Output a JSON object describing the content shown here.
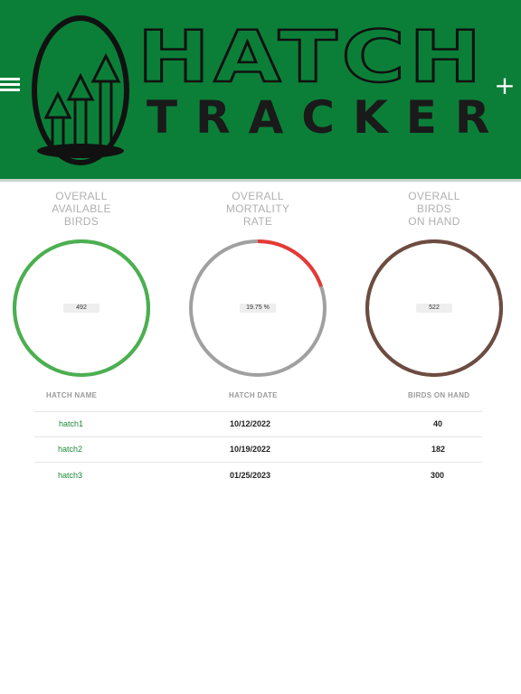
{
  "header": {
    "brand_top": "HATCH",
    "brand_bottom": "TRACKER",
    "menu_icon": "hamburger-menu-icon",
    "add_icon": "plus-icon",
    "add_label": "+"
  },
  "stats": [
    {
      "label_lines": [
        "OVERALL",
        "AVAILABLE",
        "BIRDS"
      ],
      "value": "492",
      "color": "#4caf50",
      "fraction": 1.0,
      "track_color": "#4caf50"
    },
    {
      "label_lines": [
        "OVERALL",
        "MORTALITY",
        "RATE"
      ],
      "value": "19.75 %",
      "color": "#e53935",
      "fraction": 0.1975,
      "track_color": "#a0a0a0"
    },
    {
      "label_lines": [
        "OVERALL",
        "BIRDS",
        "ON HAND"
      ],
      "value": "522",
      "color": "#6d4c41",
      "fraction": 1.0,
      "track_color": "#6d4c41"
    }
  ],
  "table": {
    "headers": [
      "HATCH NAME",
      "HATCH DATE",
      "BIRDS ON HAND"
    ],
    "rows": [
      {
        "name": "hatch1",
        "date": "10/12/2022",
        "birds": "40"
      },
      {
        "name": "hatch2",
        "date": "10/19/2022",
        "birds": "182"
      },
      {
        "name": "hatch3",
        "date": "01/25/2023",
        "birds": "300"
      }
    ]
  },
  "colors": {
    "header_bg": "#0b7f38",
    "accent_green": "#1e8b3a"
  }
}
